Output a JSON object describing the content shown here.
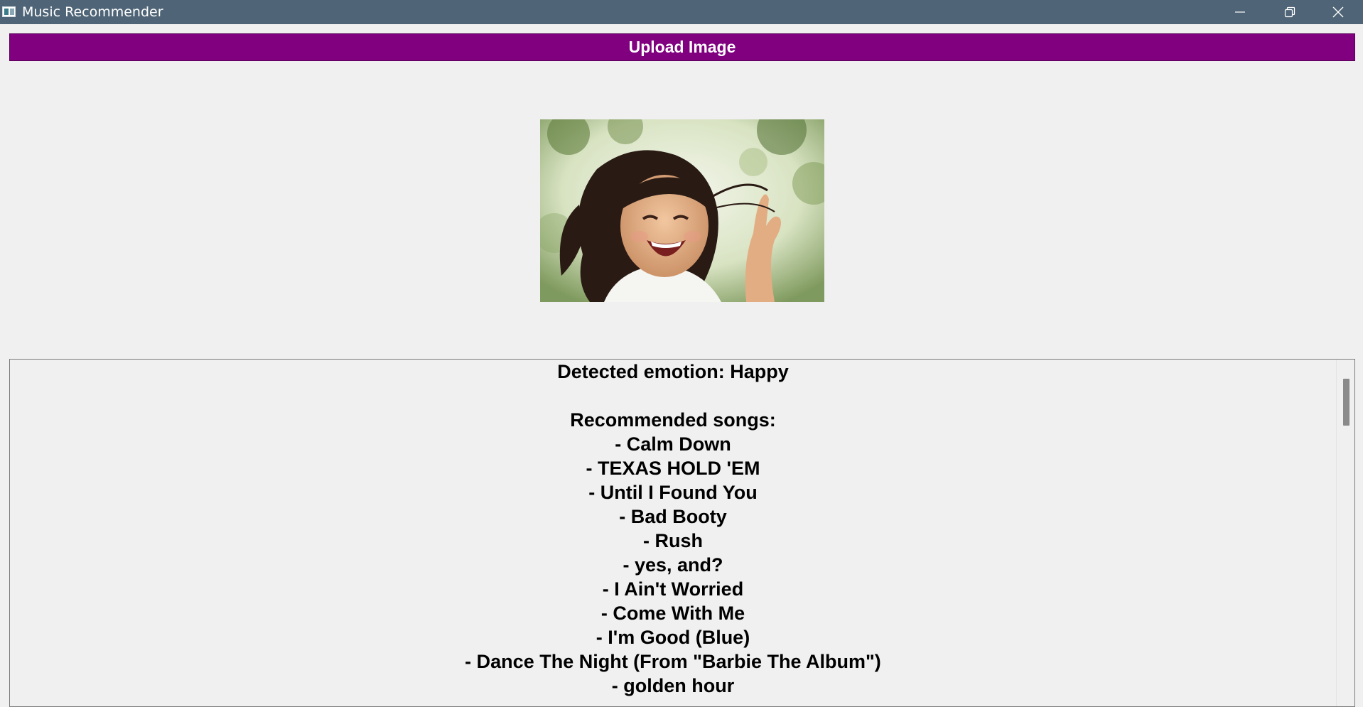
{
  "window": {
    "title": "Music Recommender",
    "controls": {
      "minimize": "minimize-icon",
      "maximize": "restore-icon",
      "close": "close-icon"
    }
  },
  "toolbar": {
    "upload_label": "Upload Image",
    "accent": "#800080"
  },
  "results": {
    "emotion_line": "Detected emotion: Happy",
    "songs_heading": "Recommended songs:",
    "songs": [
      "- Calm Down",
      "- TEXAS HOLD 'EM",
      "- Until I Found You",
      "- Bad Booty",
      "- Rush",
      "- yes, and?",
      "- I Ain't Worried",
      "- Come With Me",
      "- I'm Good (Blue)",
      "- Dance The Night (From \"Barbie The Album\")",
      "- golden hour"
    ]
  }
}
